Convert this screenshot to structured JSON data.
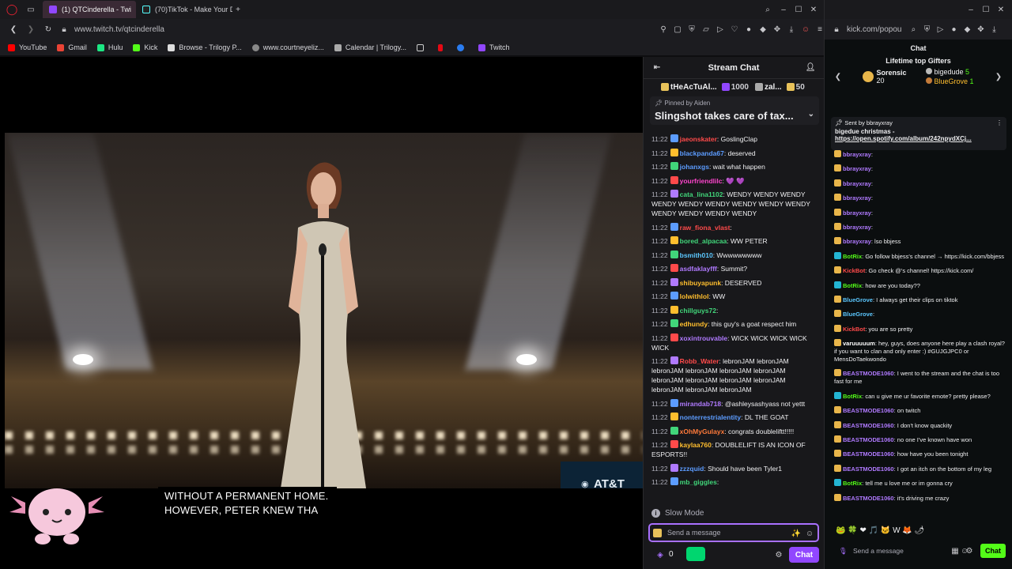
{
  "browser": {
    "tabs": [
      {
        "label": "(1) QTCinderella - Twi",
        "active": true
      },
      {
        "label": "(70)TikTok - Make Your D",
        "active": false
      }
    ],
    "url": "www.twitch.tv/qtcinderella",
    "bookmarks": [
      "YouTube",
      "Gmail",
      "Hulu",
      "Kick",
      "Browse - Trilogy P...",
      "www.courtneyeliz...",
      "Calendar | Trilogy...",
      "Twitch"
    ]
  },
  "video": {
    "captions": [
      "WITHOUT A PERMANENT HOME.",
      "HOWEVER, PETER KNEW THA"
    ],
    "sponsor": "AT&T"
  },
  "stream_chat": {
    "title": "Stream Chat",
    "gifts": [
      {
        "name": "tHeAcTuAl...",
        "count": "1000"
      },
      {
        "name": "zal...",
        "count": "50"
      }
    ],
    "pinned_by": "Pinned by Aiden",
    "pinned_message": "Slingshot takes care of tax...",
    "messages": [
      {
        "time": "11:22",
        "user": "jaeonskater",
        "color": "#ff4a4a",
        "text": ": GoslingClap"
      },
      {
        "time": "11:22",
        "user": "blackpanda67",
        "color": "#5c9cff",
        "text": ": deserved"
      },
      {
        "time": "11:22",
        "user": "johanxgs",
        "color": "#5c9cff",
        "text": ": wait what happen"
      },
      {
        "time": "11:22",
        "user": "yourfriendlilc",
        "color": "#ff44cc",
        "text": ": 💜 💜"
      },
      {
        "time": "11:22",
        "user": "cata_lina1102",
        "color": "#41d67a",
        "text": ": WENDY WENDY WENDY WENDY WENDY WENDY WENDY WENDY WENDY WENDY WENDY WENDY WENDY"
      },
      {
        "time": "11:22",
        "user": "raw_fiona_vlast",
        "color": "#ff4a4a",
        "text": ":"
      },
      {
        "time": "11:22",
        "user": "bored_alpacaa",
        "color": "#41d67a",
        "text": ": WW PETER"
      },
      {
        "time": "11:22",
        "user": "bsmith010",
        "color": "#5cc8ff",
        "text": ": Wwwwwwwww"
      },
      {
        "time": "11:22",
        "user": "asdfaklayfff",
        "color": "#b07aff",
        "text": ": Summit?"
      },
      {
        "time": "11:22",
        "user": "shibuyapunk",
        "color": "#ffbe2e",
        "text": ": DESERVED"
      },
      {
        "time": "11:22",
        "user": "lolwithlol",
        "color": "#ffbe2e",
        "text": ": WW"
      },
      {
        "time": "11:22",
        "user": "chillguys72",
        "color": "#41d67a",
        "text": ":"
      },
      {
        "time": "11:22",
        "user": "edhundy",
        "color": "#ffbe2e",
        "text": ": this guy's a goat respect him"
      },
      {
        "time": "11:22",
        "user": "xoxintrouvable",
        "color": "#b07aff",
        "text": ": WICK WICK WICK WICK WICK"
      },
      {
        "time": "11:22",
        "user": "Robb_Water",
        "color": "#ff4a4a",
        "text": ": lebronJAM lebronJAM lebronJAM lebronJAM lebronJAM lebronJAM lebronJAM lebronJAM lebronJAM lebronJAM lebronJAM lebronJAM lebronJAM"
      },
      {
        "time": "11:22",
        "user": "mirandab718",
        "color": "#b07aff",
        "text": ": @ashleysashyass not yettt"
      },
      {
        "time": "11:22",
        "user": "nonterrestrialentity",
        "color": "#5c9cff",
        "text": ": DL THE GOAT"
      },
      {
        "time": "11:22",
        "user": "xOhMyGulayx",
        "color": "#ff7a3a",
        "text": ": congrats doubleliftt!!!!!"
      },
      {
        "time": "11:22",
        "user": "kaylaa760",
        "color": "#ffbe2e",
        "text": ": DOUBLELIFT IS AN ICON OF ESPORTS!!"
      },
      {
        "time": "11:22",
        "user": "zzzquid",
        "color": "#5c9cff",
        "text": ": Should have been Tyler1"
      },
      {
        "time": "11:22",
        "user": "mb_giggles",
        "color": "#41d67a",
        "text": ":"
      }
    ],
    "slow_mode": "Slow Mode",
    "input_placeholder": "Send a message",
    "points": "0",
    "chat_button": "Chat"
  },
  "kick": {
    "url": "kick.com/popou",
    "chat_title": "Chat",
    "gifters_title": "Lifetime top Gifters",
    "gifters": [
      {
        "name": "Sorensic",
        "count": "20"
      },
      {
        "name": "bigedude",
        "count": "5"
      },
      {
        "name": "BlueGrove",
        "count": "1"
      }
    ],
    "pinned_sender": "Sent by bbrayxray",
    "pinned_text": "bigedue christmas -",
    "pinned_link": "https://open.spotify.com/album/242npydXCj...",
    "messages": [
      {
        "user": "bbrayxray",
        "color": "#b07aff",
        "text": ":"
      },
      {
        "user": "bbrayxray",
        "color": "#b07aff",
        "text": ":"
      },
      {
        "user": "bbrayxray",
        "color": "#b07aff",
        "text": ":"
      },
      {
        "user": "bbrayxray",
        "color": "#b07aff",
        "text": ":"
      },
      {
        "user": "bbrayxray",
        "color": "#b07aff",
        "text": ":"
      },
      {
        "user": "bbrayxray",
        "color": "#b07aff",
        "text": ":"
      },
      {
        "user": "bbrayxray",
        "color": "#b07aff",
        "text": ": lso bbjess"
      },
      {
        "user": "BotRix",
        "color": "#53fc18",
        "text": ": Go follow bbjess's channel → https://kick.com/bbjess"
      },
      {
        "user": "KickBot",
        "color": "#ff4a4a",
        "text": ": Go check @'s channel! https://kick.com/"
      },
      {
        "user": "BotRix",
        "color": "#53fc18",
        "text": ": how are you today??"
      },
      {
        "user": "BlueGrove",
        "color": "#5cc8ff",
        "text": ": I always get their clips on tiktok"
      },
      {
        "user": "BlueGrove",
        "color": "#5cc8ff",
        "text": ":"
      },
      {
        "user": "KickBot",
        "color": "#ff4a4a",
        "text": ": you are so pretty"
      },
      {
        "user": "varuuuuum",
        "color": "#ffffff",
        "text": ": hey, guys, does anyone here play a clash royal? if you want to clan and only enter :) #GUJGJPC0 or MensDoTaekwondo"
      },
      {
        "user": "BEASTMODE1060",
        "color": "#b07aff",
        "text": ": I went to the stream and the chat is too fast for me"
      },
      {
        "user": "BotRix",
        "color": "#53fc18",
        "text": ": can u give me ur favorite emote? pretty please?"
      },
      {
        "user": "BEASTMODE1060",
        "color": "#b07aff",
        "text": ": on twitch"
      },
      {
        "user": "BEASTMODE1060",
        "color": "#b07aff",
        "text": ": I don't know quackity"
      },
      {
        "user": "BEASTMODE1060",
        "color": "#b07aff",
        "text": ": no one I've known have won"
      },
      {
        "user": "BEASTMODE1060",
        "color": "#b07aff",
        "text": ": how have you been tonight"
      },
      {
        "user": "BEASTMODE1060",
        "color": "#b07aff",
        "text": ": I got an itch on the bottom of my leg"
      },
      {
        "user": "BotRix",
        "color": "#53fc18",
        "text": ": tell me u love me or im gonna cry"
      },
      {
        "user": "BEASTMODE1060",
        "color": "#b07aff",
        "text": ": it's driving me crazy"
      }
    ],
    "input_placeholder": "Send a message",
    "chat_button": "Chat"
  },
  "colors": {
    "twitch_purple": "#9147ff",
    "kick_green": "#53fc18"
  }
}
